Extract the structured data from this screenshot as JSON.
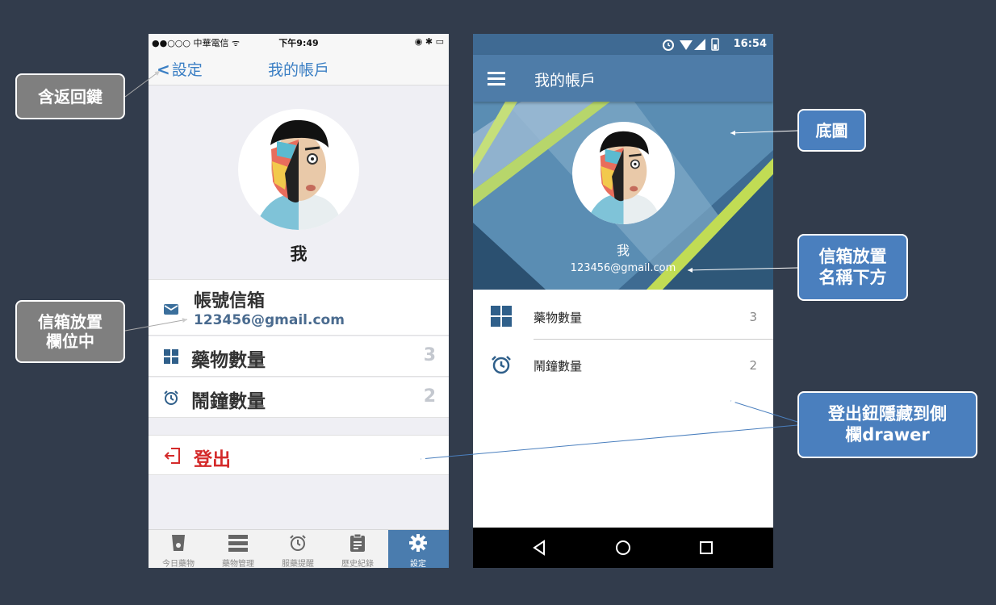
{
  "ios": {
    "status": {
      "carrier": "●●○○○ 中華電信 ᯤ",
      "time": "下午9:49",
      "right": "◉ ✱ ▭"
    },
    "nav": {
      "back_label": "設定",
      "title": "我的帳戶"
    },
    "profile": {
      "name": "我"
    },
    "email_row": {
      "label": "帳號信箱",
      "value": "123456@gmail.com"
    },
    "rows": [
      {
        "label": "藥物數量",
        "value": "3",
        "icon": "grid-icon"
      },
      {
        "label": "鬧鐘數量",
        "value": "2",
        "icon": "alarm-clock-icon"
      }
    ],
    "logout_label": "登出",
    "tabs": [
      {
        "label": "今日藥物",
        "icon": "cup-icon"
      },
      {
        "label": "藥物管理",
        "icon": "list-icon"
      },
      {
        "label": "服藥提醒",
        "icon": "alarm-clock-icon"
      },
      {
        "label": "歷史紀錄",
        "icon": "clipboard-icon"
      },
      {
        "label": "設定",
        "icon": "gear-icon"
      }
    ],
    "active_tab_color": "#4a7cae",
    "logout_color": "#d42a2a"
  },
  "android": {
    "status": {
      "time": "16:54"
    },
    "app_bar": {
      "title": "我的帳戶"
    },
    "header": {
      "name": "我",
      "email": "123456@gmail.com"
    },
    "rows": [
      {
        "label": "藥物數量",
        "value": "3",
        "icon": "grid-icon"
      },
      {
        "label": "鬧鐘數量",
        "value": "2",
        "icon": "alarm-clock-icon"
      }
    ],
    "app_bar_color": "#4e7ca8"
  },
  "callouts": {
    "back_key": "含返回鍵",
    "email_in_field": [
      "信箱放置",
      "欄位中"
    ],
    "background_image": "底圖",
    "email_below_name": [
      "信箱放置",
      "名稱下方"
    ],
    "logout_hidden": [
      "登出鈕隱藏到側",
      "欄drawer"
    ]
  }
}
